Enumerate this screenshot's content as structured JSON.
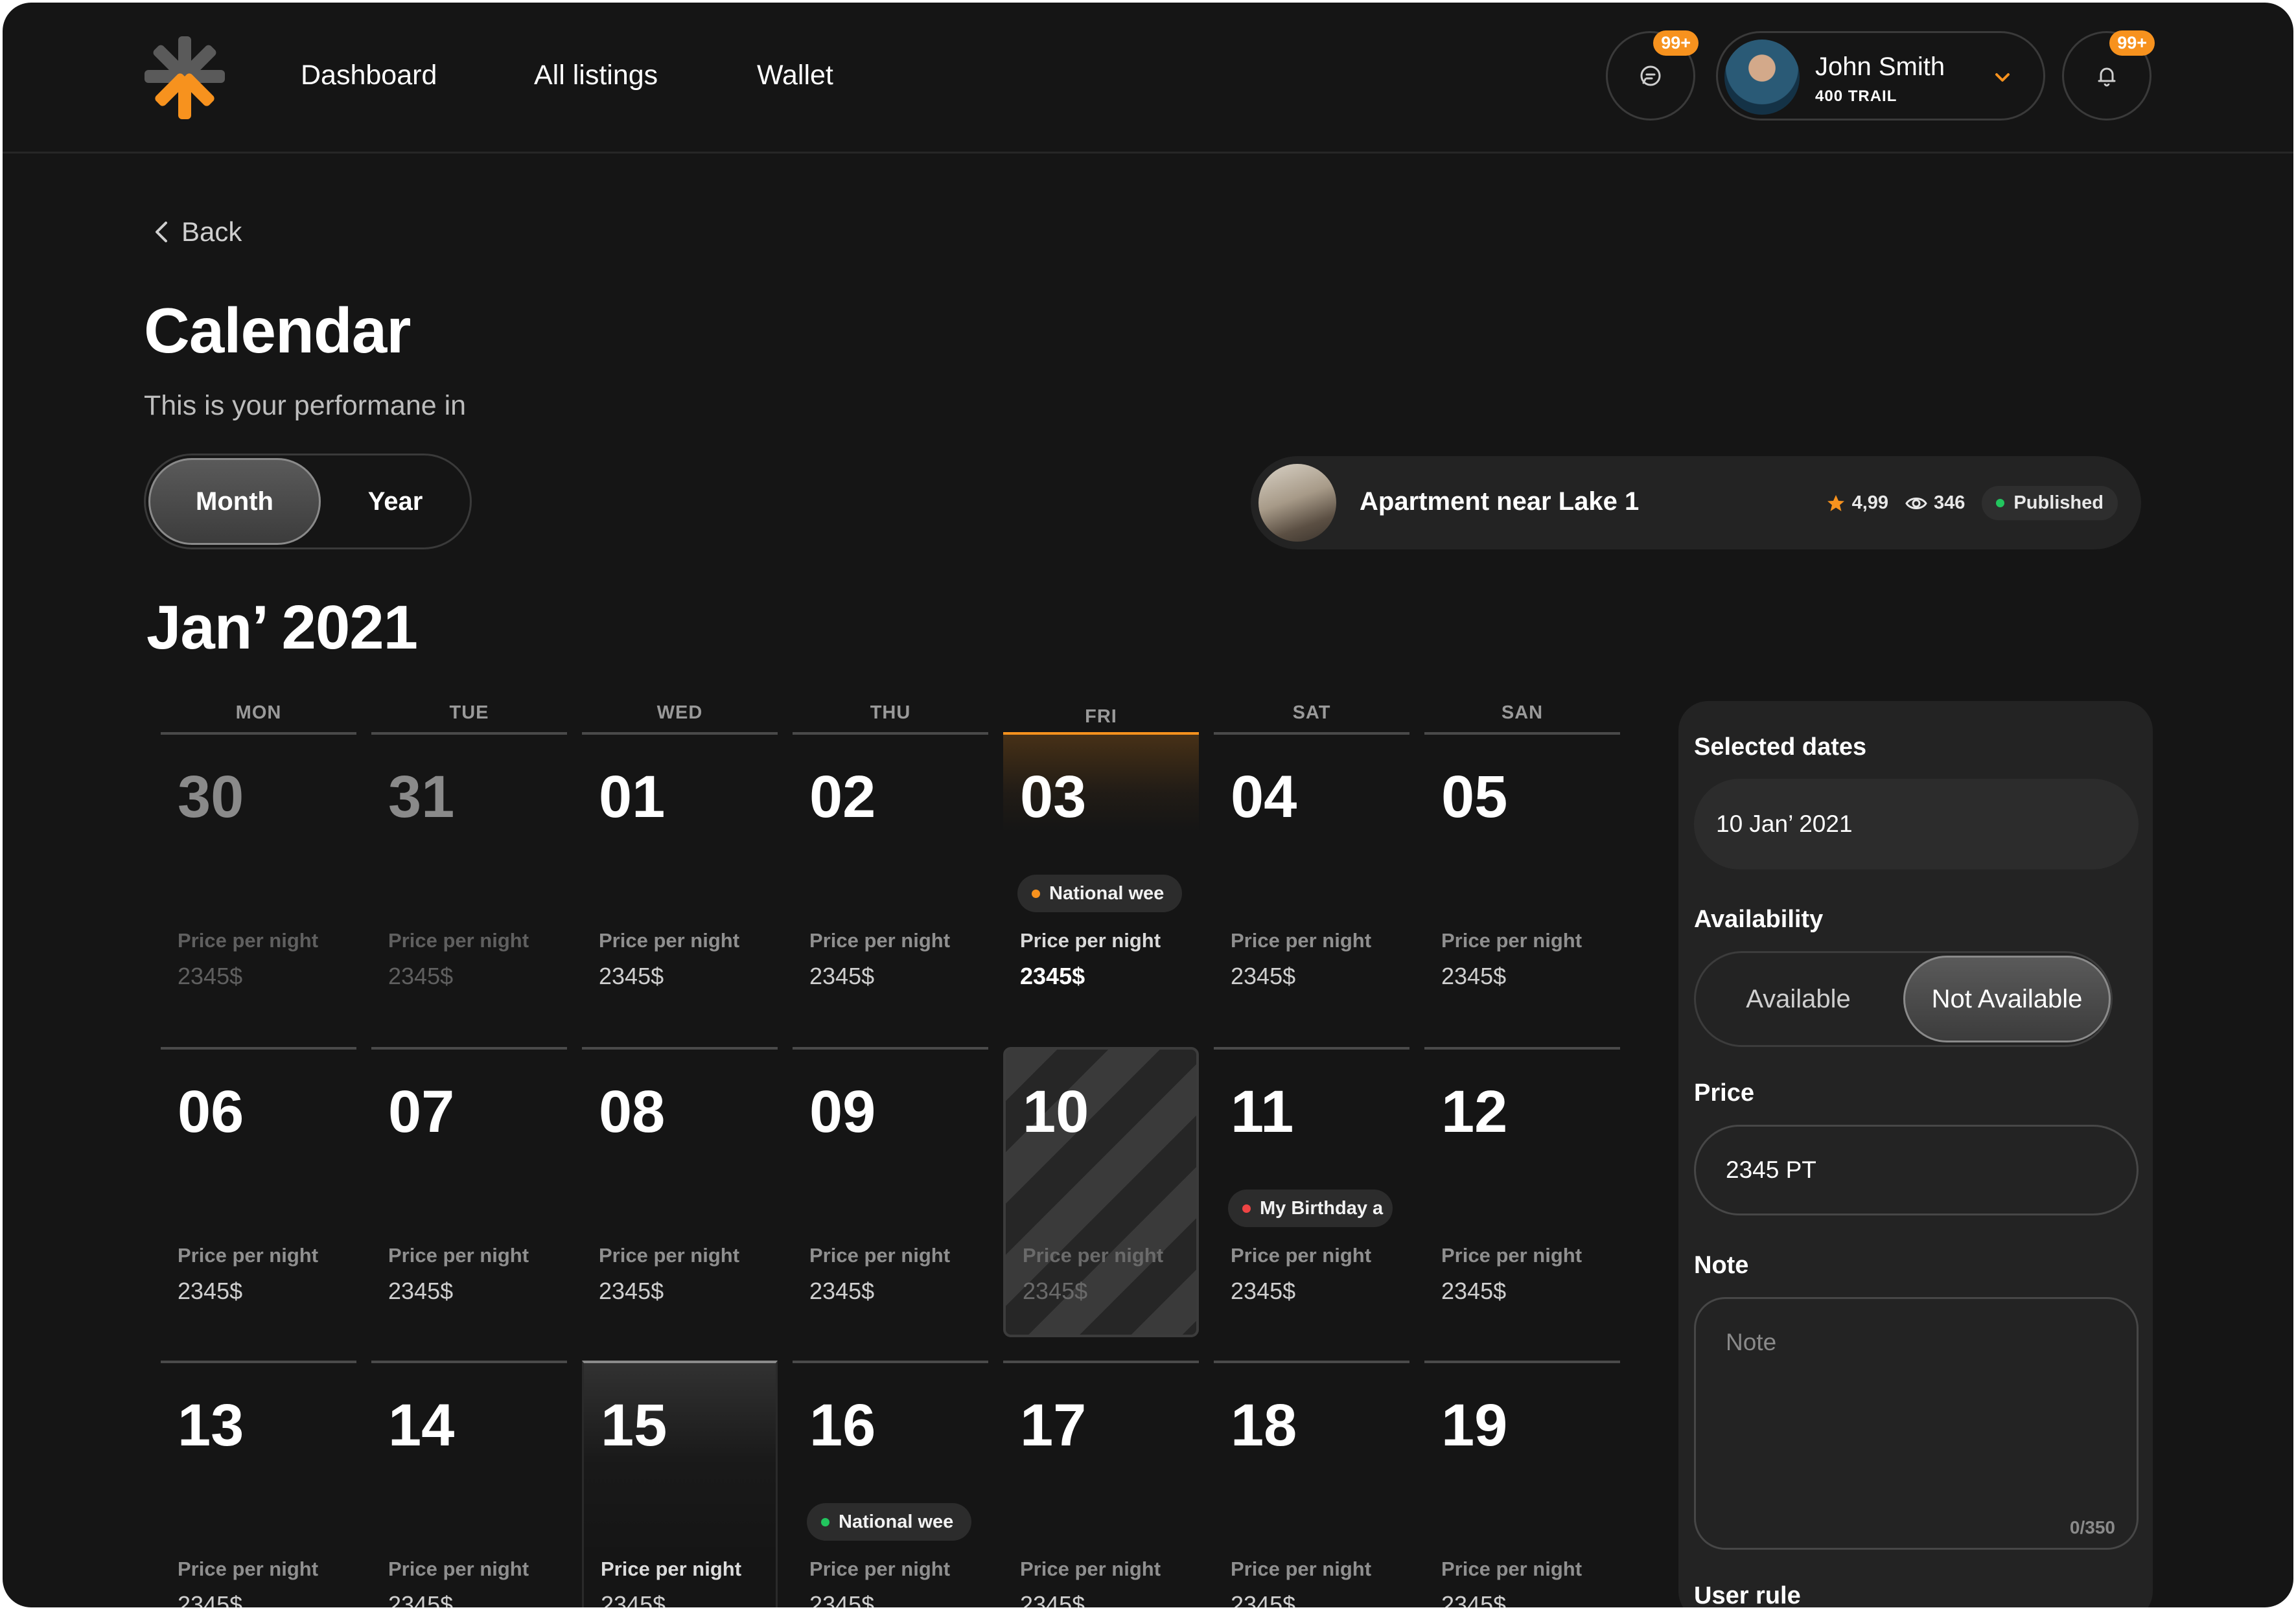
{
  "header": {
    "nav": [
      "Dashboard",
      "All listings",
      "Wallet"
    ],
    "messages_badge": "99+",
    "notifications_badge": "99+",
    "user": {
      "name": "John Smith",
      "plan": "400 TRAIL"
    },
    "accent_color": "#f7921e"
  },
  "page": {
    "back_label": "Back",
    "title": "Calendar",
    "subtitle": "This is your performane in",
    "view_toggle": {
      "options": [
        "Month",
        "Year"
      ],
      "selected": "Month"
    },
    "month_label": "Jan’ 2021"
  },
  "listing": {
    "name": "Apartment near Lake 1",
    "rating": "4,99",
    "views": "346",
    "status": "Published",
    "status_color": "#22c55e",
    "rating_icon": "star-icon",
    "views_icon": "eye-icon"
  },
  "calendar": {
    "weekdays": [
      "MON",
      "TUE",
      "WED",
      "THU",
      "FRI",
      "SAT",
      "SAN"
    ],
    "price_label": "Price per night",
    "weeks": [
      [
        {
          "day": "30",
          "price": "2345$",
          "muted": true
        },
        {
          "day": "31",
          "price": "2345$",
          "muted": true
        },
        {
          "day": "01",
          "price": "2345$"
        },
        {
          "day": "02",
          "price": "2345$"
        },
        {
          "day": "03",
          "price": "2345$",
          "today": true,
          "event": {
            "text": "National wee",
            "color": "#f7921e"
          }
        },
        {
          "day": "04",
          "price": "2345$"
        },
        {
          "day": "05",
          "price": "2345$"
        }
      ],
      [
        {
          "day": "06",
          "price": "2345$"
        },
        {
          "day": "07",
          "price": "2345$"
        },
        {
          "day": "08",
          "price": "2345$"
        },
        {
          "day": "09",
          "price": "2345$"
        },
        {
          "day": "10",
          "price": "2345$",
          "selected": true
        },
        {
          "day": "11",
          "price": "2345$",
          "event": {
            "text": "My Birthday a",
            "color": "#ef4444"
          }
        },
        {
          "day": "12",
          "price": "2345$"
        }
      ],
      [
        {
          "day": "13",
          "price": "2345$"
        },
        {
          "day": "14",
          "price": "2345$"
        },
        {
          "day": "15",
          "price": "2345$",
          "hover": true
        },
        {
          "day": "16",
          "price": "2345$",
          "event": {
            "text": "National wee",
            "color": "#22c55e"
          }
        },
        {
          "day": "17",
          "price": "2345$"
        },
        {
          "day": "18",
          "price": "2345$"
        },
        {
          "day": "19",
          "price": "2345$"
        }
      ]
    ]
  },
  "panel": {
    "selected_dates_label": "Selected dates",
    "selected_dates_value": "10 Jan’ 2021",
    "availability_label": "Availability",
    "availability_options": [
      "Available",
      "Not Available"
    ],
    "availability_selected": "Not Available",
    "price_label": "Price",
    "price_value": "2345 PT",
    "note_label": "Note",
    "note_placeholder": "Note",
    "note_counter": "0/350",
    "user_rule_label": "User rule"
  }
}
